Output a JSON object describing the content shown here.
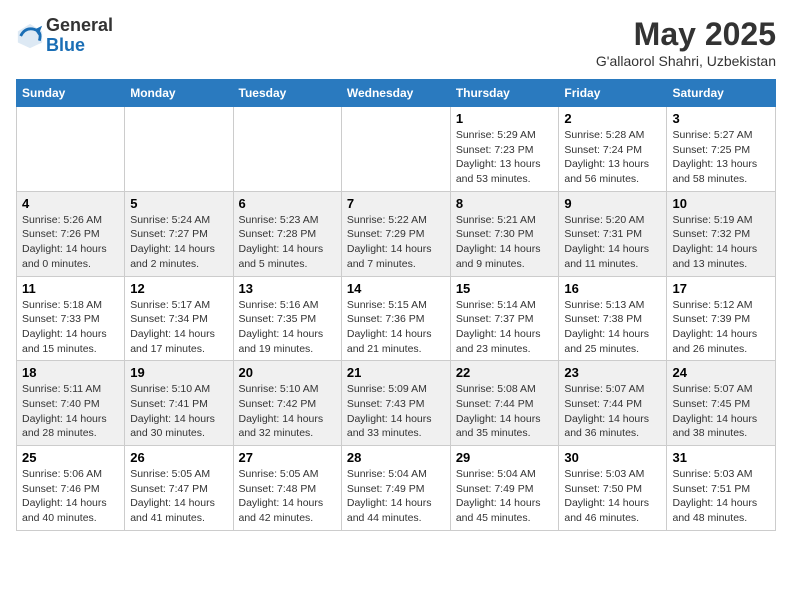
{
  "logo": {
    "general": "General",
    "blue": "Blue"
  },
  "title": "May 2025",
  "location": "G'allaorol Shahri, Uzbekistan",
  "days_header": [
    "Sunday",
    "Monday",
    "Tuesday",
    "Wednesday",
    "Thursday",
    "Friday",
    "Saturday"
  ],
  "weeks": [
    [
      {
        "day": "",
        "info": ""
      },
      {
        "day": "",
        "info": ""
      },
      {
        "day": "",
        "info": ""
      },
      {
        "day": "",
        "info": ""
      },
      {
        "day": "1",
        "info": "Sunrise: 5:29 AM\nSunset: 7:23 PM\nDaylight: 13 hours and 53 minutes."
      },
      {
        "day": "2",
        "info": "Sunrise: 5:28 AM\nSunset: 7:24 PM\nDaylight: 13 hours and 56 minutes."
      },
      {
        "day": "3",
        "info": "Sunrise: 5:27 AM\nSunset: 7:25 PM\nDaylight: 13 hours and 58 minutes."
      }
    ],
    [
      {
        "day": "4",
        "info": "Sunrise: 5:26 AM\nSunset: 7:26 PM\nDaylight: 14 hours and 0 minutes."
      },
      {
        "day": "5",
        "info": "Sunrise: 5:24 AM\nSunset: 7:27 PM\nDaylight: 14 hours and 2 minutes."
      },
      {
        "day": "6",
        "info": "Sunrise: 5:23 AM\nSunset: 7:28 PM\nDaylight: 14 hours and 5 minutes."
      },
      {
        "day": "7",
        "info": "Sunrise: 5:22 AM\nSunset: 7:29 PM\nDaylight: 14 hours and 7 minutes."
      },
      {
        "day": "8",
        "info": "Sunrise: 5:21 AM\nSunset: 7:30 PM\nDaylight: 14 hours and 9 minutes."
      },
      {
        "day": "9",
        "info": "Sunrise: 5:20 AM\nSunset: 7:31 PM\nDaylight: 14 hours and 11 minutes."
      },
      {
        "day": "10",
        "info": "Sunrise: 5:19 AM\nSunset: 7:32 PM\nDaylight: 14 hours and 13 minutes."
      }
    ],
    [
      {
        "day": "11",
        "info": "Sunrise: 5:18 AM\nSunset: 7:33 PM\nDaylight: 14 hours and 15 minutes."
      },
      {
        "day": "12",
        "info": "Sunrise: 5:17 AM\nSunset: 7:34 PM\nDaylight: 14 hours and 17 minutes."
      },
      {
        "day": "13",
        "info": "Sunrise: 5:16 AM\nSunset: 7:35 PM\nDaylight: 14 hours and 19 minutes."
      },
      {
        "day": "14",
        "info": "Sunrise: 5:15 AM\nSunset: 7:36 PM\nDaylight: 14 hours and 21 minutes."
      },
      {
        "day": "15",
        "info": "Sunrise: 5:14 AM\nSunset: 7:37 PM\nDaylight: 14 hours and 23 minutes."
      },
      {
        "day": "16",
        "info": "Sunrise: 5:13 AM\nSunset: 7:38 PM\nDaylight: 14 hours and 25 minutes."
      },
      {
        "day": "17",
        "info": "Sunrise: 5:12 AM\nSunset: 7:39 PM\nDaylight: 14 hours and 26 minutes."
      }
    ],
    [
      {
        "day": "18",
        "info": "Sunrise: 5:11 AM\nSunset: 7:40 PM\nDaylight: 14 hours and 28 minutes."
      },
      {
        "day": "19",
        "info": "Sunrise: 5:10 AM\nSunset: 7:41 PM\nDaylight: 14 hours and 30 minutes."
      },
      {
        "day": "20",
        "info": "Sunrise: 5:10 AM\nSunset: 7:42 PM\nDaylight: 14 hours and 32 minutes."
      },
      {
        "day": "21",
        "info": "Sunrise: 5:09 AM\nSunset: 7:43 PM\nDaylight: 14 hours and 33 minutes."
      },
      {
        "day": "22",
        "info": "Sunrise: 5:08 AM\nSunset: 7:44 PM\nDaylight: 14 hours and 35 minutes."
      },
      {
        "day": "23",
        "info": "Sunrise: 5:07 AM\nSunset: 7:44 PM\nDaylight: 14 hours and 36 minutes."
      },
      {
        "day": "24",
        "info": "Sunrise: 5:07 AM\nSunset: 7:45 PM\nDaylight: 14 hours and 38 minutes."
      }
    ],
    [
      {
        "day": "25",
        "info": "Sunrise: 5:06 AM\nSunset: 7:46 PM\nDaylight: 14 hours and 40 minutes."
      },
      {
        "day": "26",
        "info": "Sunrise: 5:05 AM\nSunset: 7:47 PM\nDaylight: 14 hours and 41 minutes."
      },
      {
        "day": "27",
        "info": "Sunrise: 5:05 AM\nSunset: 7:48 PM\nDaylight: 14 hours and 42 minutes."
      },
      {
        "day": "28",
        "info": "Sunrise: 5:04 AM\nSunset: 7:49 PM\nDaylight: 14 hours and 44 minutes."
      },
      {
        "day": "29",
        "info": "Sunrise: 5:04 AM\nSunset: 7:49 PM\nDaylight: 14 hours and 45 minutes."
      },
      {
        "day": "30",
        "info": "Sunrise: 5:03 AM\nSunset: 7:50 PM\nDaylight: 14 hours and 46 minutes."
      },
      {
        "day": "31",
        "info": "Sunrise: 5:03 AM\nSunset: 7:51 PM\nDaylight: 14 hours and 48 minutes."
      }
    ]
  ]
}
